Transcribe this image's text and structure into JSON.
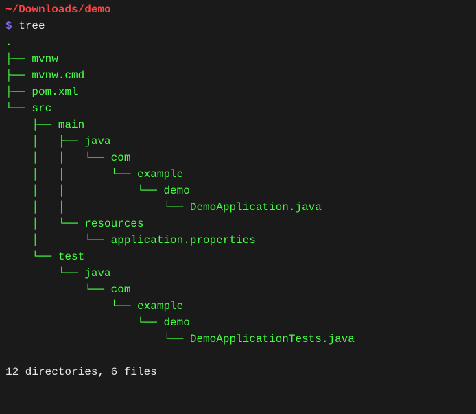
{
  "cwd": "~/Downloads/demo",
  "prompt_symbol": "$ ",
  "command": "tree",
  "tree_lines": [
    ".",
    "├── mvnw",
    "├── mvnw.cmd",
    "├── pom.xml",
    "└── src",
    "    ├── main",
    "    │   ├── java",
    "    │   │   └── com",
    "    │   │       └── example",
    "    │   │           └── demo",
    "    │   │               └── DemoApplication.java",
    "    │   └── resources",
    "    │       └── application.properties",
    "    └── test",
    "        └── java",
    "            └── com",
    "                └── example",
    "                    └── demo",
    "                        └── DemoApplicationTests.java"
  ],
  "summary": "12 directories, 6 files"
}
